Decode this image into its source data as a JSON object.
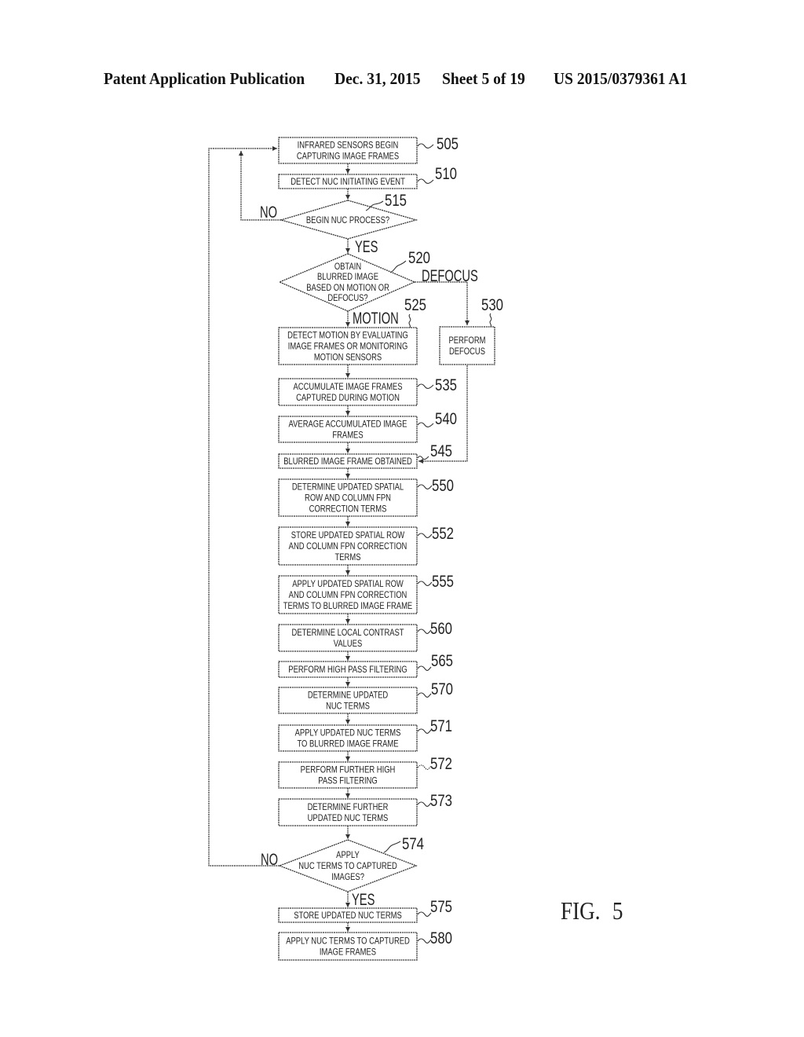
{
  "header": {
    "publication_type": "Patent Application Publication",
    "date": "Dec. 31, 2015",
    "sheet": "Sheet 5 of 19",
    "publication_number": "US 2015/0379361 A1"
  },
  "figure_label": "FIG. 5",
  "steps": {
    "s505": {
      "ref": "505",
      "lines": [
        "INFRARED SENSORS BEGIN",
        "CAPTURING IMAGE FRAMES"
      ]
    },
    "s510": {
      "ref": "510",
      "lines": [
        "DETECT NUC INITIATING EVENT"
      ]
    },
    "s515": {
      "ref": "515",
      "lines": [
        "BEGIN NUC PROCESS?"
      ]
    },
    "s520": {
      "ref": "520",
      "lines": [
        "OBTAIN",
        "BLURRED IMAGE",
        "BASED ON MOTION OR",
        "DEFOCUS?"
      ]
    },
    "s525": {
      "ref": "525",
      "lines": [
        "DETECT MOTION BY EVALUATING",
        "IMAGE FRAMES OR MONITORING",
        "MOTION SENSORS"
      ]
    },
    "s530": {
      "ref": "530",
      "lines": [
        "PERFORM",
        "DEFOCUS"
      ]
    },
    "s535": {
      "ref": "535",
      "lines": [
        "ACCUMULATE IMAGE FRAMES",
        "CAPTURED DURING MOTION"
      ]
    },
    "s540": {
      "ref": "540",
      "lines": [
        "AVERAGE ACCUMULATED IMAGE",
        "FRAMES"
      ]
    },
    "s545": {
      "ref": "545",
      "lines": [
        "BLURRED IMAGE FRAME OBTAINED"
      ]
    },
    "s550": {
      "ref": "550",
      "lines": [
        "DETERMINE UPDATED SPATIAL",
        "ROW AND COLUMN FPN",
        "CORRECTION TERMS"
      ]
    },
    "s552": {
      "ref": "552",
      "lines": [
        "STORE UPDATED SPATIAL ROW",
        "AND COLUMN FPN CORRECTION",
        "TERMS"
      ]
    },
    "s555": {
      "ref": "555",
      "lines": [
        "APPLY UPDATED SPATIAL ROW",
        "AND COLUMN FPN CORRECTION",
        "TERMS TO BLURRED IMAGE FRAME"
      ]
    },
    "s560": {
      "ref": "560",
      "lines": [
        "DETERMINE LOCAL CONTRAST",
        "VALUES"
      ]
    },
    "s565": {
      "ref": "565",
      "lines": [
        "PERFORM HIGH PASS FILTERING"
      ]
    },
    "s570": {
      "ref": "570",
      "lines": [
        "DETERMINE UPDATED",
        "NUC TERMS"
      ]
    },
    "s571": {
      "ref": "571",
      "lines": [
        "APPLY UPDATED NUC TERMS",
        "TO BLURRED IMAGE FRAME"
      ]
    },
    "s572": {
      "ref": "572",
      "lines": [
        "PERFORM FURTHER HIGH",
        "PASS FILTERING"
      ]
    },
    "s573": {
      "ref": "573",
      "lines": [
        "DETERMINE FURTHER",
        "UPDATED NUC TERMS"
      ]
    },
    "s574": {
      "ref": "574",
      "lines": [
        "APPLY",
        "NUC TERMS TO CAPTURED",
        "IMAGES?"
      ]
    },
    "s575": {
      "ref": "575",
      "lines": [
        "STORE UPDATED NUC TERMS"
      ]
    },
    "s580": {
      "ref": "580",
      "lines": [
        "APPLY NUC TERMS TO CAPTURED",
        "IMAGE FRAMES"
      ]
    }
  },
  "branches": {
    "d515_no": "NO",
    "d515_yes": "YES",
    "d520_defocus": "DEFOCUS",
    "d520_motion": "MOTION",
    "d574_no": "NO",
    "d574_yes": "YES"
  }
}
